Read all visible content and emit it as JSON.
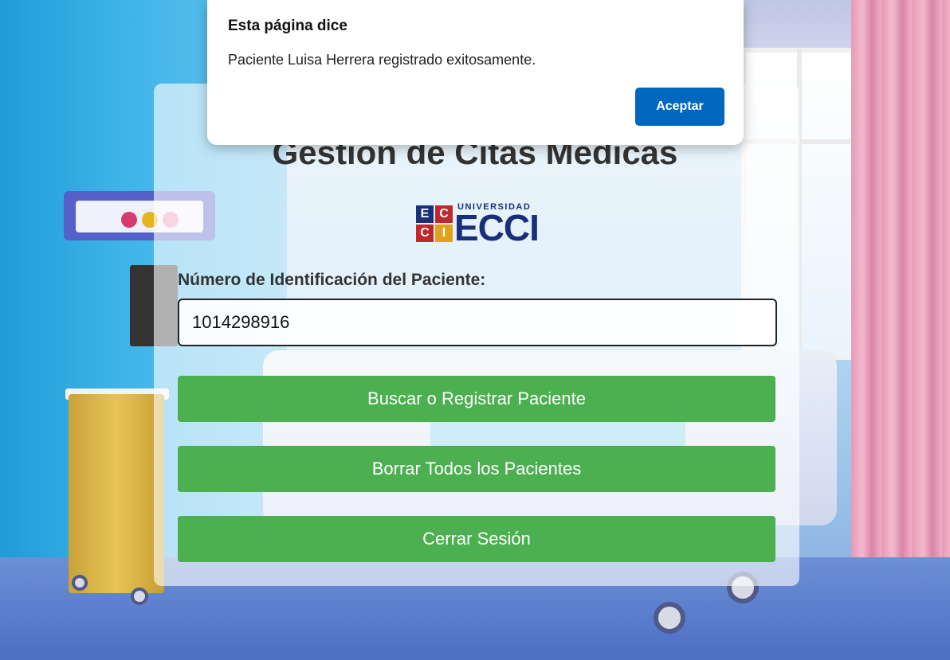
{
  "dialog": {
    "title": "Esta página dice",
    "message": "Paciente Luisa Herrera registrado exitosamente.",
    "ok_label": "Aceptar"
  },
  "page": {
    "title": "Gestion de Citas Medicas"
  },
  "logo": {
    "small_text": "UNIVERSIDAD",
    "big_text": "ECCI",
    "letters": [
      "E",
      "C",
      "C",
      "I"
    ],
    "colors": [
      "#1a2f7a",
      "#c0282d",
      "#c0282d",
      "#e0a21b"
    ]
  },
  "form": {
    "id_label": "Número de Identificación del Paciente:",
    "id_value": "1014298916",
    "search_button": "Buscar o Registrar Paciente",
    "delete_button": "Borrar Todos los Pacientes",
    "logout_button": "Cerrar Sesión"
  },
  "colors": {
    "button_green": "#4caf50",
    "dialog_blue": "#0067c0",
    "title_gray": "#333333"
  }
}
